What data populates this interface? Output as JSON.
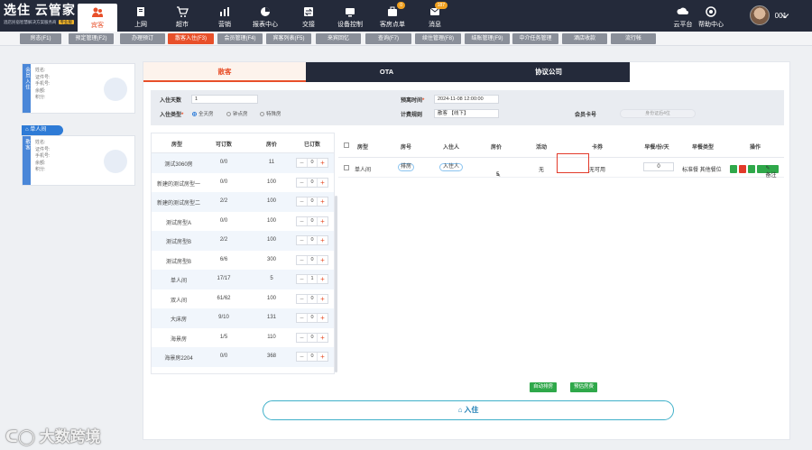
{
  "brand": {
    "title": "选住 云管家",
    "subtitle": "酒店民宿智慧解决方案服务商",
    "version": "专业版"
  },
  "topnav": [
    {
      "label": "宾客",
      "icon": "guest-icon",
      "active": true
    },
    {
      "label": "上网",
      "icon": "monitor-icon"
    },
    {
      "label": "超市",
      "icon": "cart-icon"
    },
    {
      "label": "营销",
      "icon": "chart-icon"
    },
    {
      "label": "报表中心",
      "icon": "pie-icon"
    },
    {
      "label": "交接",
      "icon": "handover-icon"
    },
    {
      "label": "设备控制",
      "icon": "device-icon"
    },
    {
      "label": "客房点单",
      "icon": "order-icon",
      "badge": "0"
    },
    {
      "label": "消息",
      "icon": "message-icon",
      "badge": "187"
    }
  ],
  "right_nav": [
    {
      "label": "云平台",
      "icon": "cloud-icon"
    },
    {
      "label": "帮助中心",
      "icon": "help-icon"
    }
  ],
  "user": {
    "name": "001"
  },
  "tabs": [
    "房态(F1)",
    "预定管理(F2)",
    "办理预订",
    "散客入住(F3)",
    "会员管理(F4)",
    "宾客列表(F5)",
    "来宾回忆",
    "查询(F7)",
    "续住管理(F8)",
    "结账管理(F9)",
    "中介任务管理",
    "酒店收款",
    "流行帐"
  ],
  "guest_card": {
    "side_label": "会员入住",
    "side_label_2": "散客",
    "fields": [
      "姓名:",
      "证件号:",
      "手机号:",
      "余额:",
      "积分:"
    ]
  },
  "room_chip": "单人间",
  "segments": [
    "散客",
    "OTA",
    "协议公司"
  ],
  "form": {
    "days_label": "入住天数",
    "days_value": "1",
    "type_label": "入住类型",
    "type_options": [
      "全天房",
      "钟点房",
      "特殊房"
    ],
    "checkout_label": "预离时间",
    "checkout_value": "2024-11-08 12:00:00",
    "rule_label": "计费规则",
    "rule_value": "散客 【线下】",
    "member_label": "会员卡号",
    "member_placeholder": "身份证后4位"
  },
  "room_types": {
    "headers": [
      "房型",
      "可订数",
      "房价",
      "已订数"
    ],
    "rows": [
      {
        "name": "测试3060房",
        "avail": "0/0",
        "price": "11",
        "booked": "0"
      },
      {
        "name": "新建的测试房型一",
        "avail": "0/0",
        "price": "100",
        "booked": "0"
      },
      {
        "name": "新建的测试房型二",
        "avail": "2/2",
        "price": "100",
        "booked": "0"
      },
      {
        "name": "测试房型A",
        "avail": "0/0",
        "price": "100",
        "booked": "0"
      },
      {
        "name": "测试房型B",
        "avail": "2/2",
        "price": "100",
        "booked": "0"
      },
      {
        "name": "测试房型B",
        "avail": "6/6",
        "price": "300",
        "booked": "0"
      },
      {
        "name": "单人间",
        "avail": "17/17",
        "price": "5",
        "booked": "1"
      },
      {
        "name": "双人间",
        "avail": "61/62",
        "price": "100",
        "booked": "0"
      },
      {
        "name": "大床房",
        "avail": "9/10",
        "price": "131",
        "booked": "0"
      },
      {
        "name": "海景房",
        "avail": "1/5",
        "price": "110",
        "booked": "0"
      },
      {
        "name": "海景房2204",
        "avail": "0/0",
        "price": "368",
        "booked": "0"
      }
    ]
  },
  "booking": {
    "headers": [
      "房型",
      "房号",
      "入住人",
      "房价",
      "活动",
      "卡券",
      "早餐/份/天",
      "早餐类型",
      "操作"
    ],
    "row": {
      "room_type": "单人间",
      "room_no": "排房",
      "guest": "入住人",
      "price": "5",
      "activity": "无",
      "coupon": "无可用",
      "breakfast": "0",
      "breakfast_type": "标准餐 其他餐位",
      "remark_button": "备注"
    }
  },
  "auto_buttons": [
    "自动排房",
    "预估房费"
  ],
  "checkin_button": "入住",
  "watermark": "大数跨境"
}
